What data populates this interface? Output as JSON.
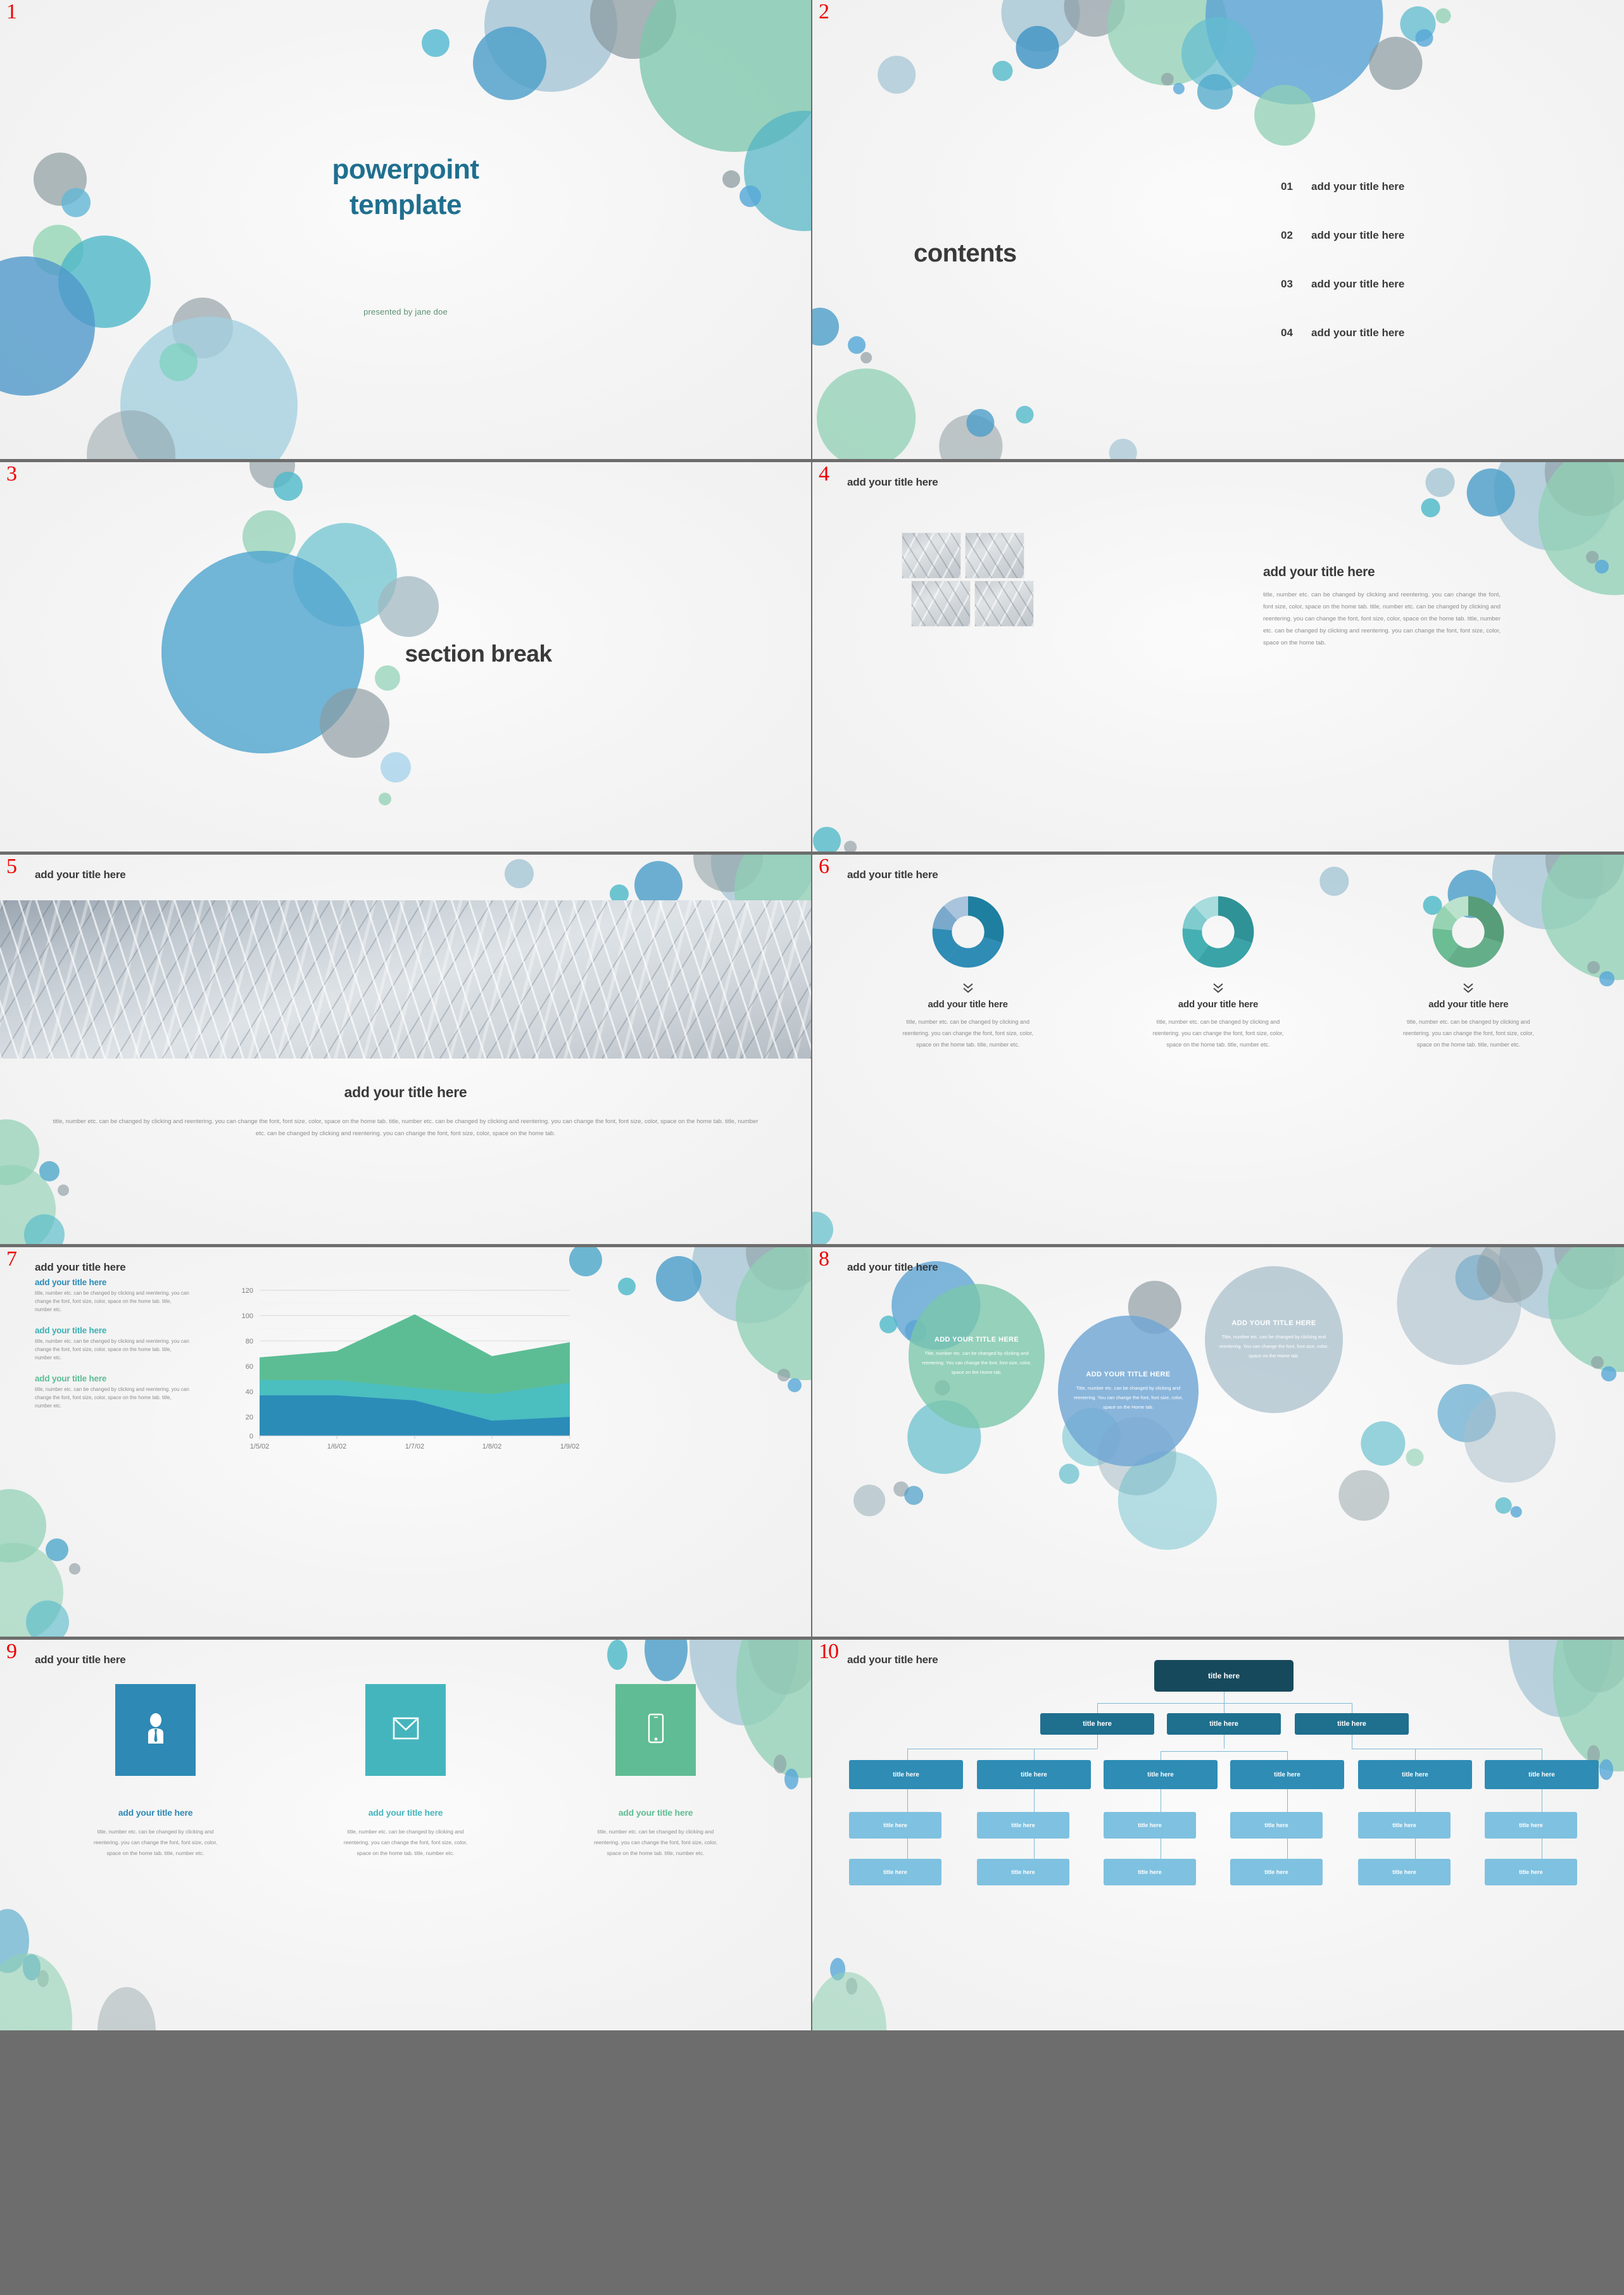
{
  "deck": {
    "slide_numbers": [
      "1",
      "2",
      "3",
      "4",
      "5",
      "6",
      "7",
      "8",
      "9",
      "10"
    ]
  },
  "slide1": {
    "title_line1": "powerpoint",
    "title_line2": "template",
    "subtitle": "presented by jane doe",
    "title_color": "#1f6f8f",
    "subtitle_color": "#5c8f73"
  },
  "slide2": {
    "heading": "contents",
    "items": [
      {
        "num": "01",
        "label": "add your title here"
      },
      {
        "num": "02",
        "label": "add your title here"
      },
      {
        "num": "03",
        "label": "add your title here"
      },
      {
        "num": "04",
        "label": "add your title here"
      }
    ]
  },
  "slide3": {
    "title": "section break"
  },
  "slide4": {
    "header": "add your title here",
    "body_title": "add your title here",
    "body_text": "title, number etc. can be changed by clicking and reentering. you can change the font, font size, color, space on the home tab. title, number etc. can be changed by clicking and reentering. you can change the font, font size, color, space on the home tab. title, number etc. can be changed by clicking and reentering. you can change the font, font size, color, space on the home tab.",
    "image_count": 4
  },
  "slide5": {
    "header": "add your title here",
    "title": "add your title here",
    "body_text": "title, number etc. can be changed by clicking and reentering. you can change the font, font size, color, space on the home tab. title, number etc. can be changed by clicking and reentering. you can change the font, font size, color, space on the home tab. title, number etc. can be changed by clicking and reentering. you can change the font, font size, color, space on the home tab."
  },
  "slide6": {
    "header": "add your title here",
    "columns": [
      {
        "title": "add your title here",
        "text": "title, number etc. can be changed by clicking and reentering. you can change the font, font size, color, space on the home tab. title, number etc."
      },
      {
        "title": "add your title here",
        "text": "title, number etc. can be changed by clicking and reentering. you can change the font, font size, color, space on the home tab. title, number etc."
      },
      {
        "title": "add your title here",
        "text": "title, number etc. can be changed by clicking and reentering. you can change the font, font size, color, space on the home tab. title, number etc."
      }
    ]
  },
  "slide7": {
    "header": "add your title here",
    "blocks": [
      {
        "title": "add your title here",
        "text": "title, number etc. can be changed by clicking and reentering. you can change the font, font size, color, space on the home tab. title, number etc.",
        "color": "#2b8cb8"
      },
      {
        "title": "add your title here",
        "text": "title, number etc. can be changed by clicking and reentering. you can change the font, font size, color, space on the home tab. title, number etc.",
        "color": "#3cb0b5"
      },
      {
        "title": "add your title here",
        "text": "title, number etc. can be changed by clicking and reentering. you can change the font, font size, color, space on the home tab. title, number etc.",
        "color": "#5cbd95"
      }
    ]
  },
  "slide8": {
    "header": "add your title here",
    "bubbles": [
      {
        "title": "ADD YOUR TITLE HERE",
        "text": "Title, number etc. can be changed by clicking and reentering. You can change the font, font size, color, space on the Home tab.",
        "color": "#7ac7ab"
      },
      {
        "title": "ADD YOUR TITLE HERE",
        "text": "Title, number etc. can be changed by clicking and reentering. You can change the font, font size, color, space on the Home tab.",
        "color": "#70a6d4"
      },
      {
        "title": "ADD YOUR TITLE HERE",
        "text": "Title, number etc. can be changed by clicking and reentering. You can change the font, font size, color, space on the Home tab.",
        "color": "#a8becb"
      }
    ]
  },
  "slide9": {
    "header": "add your title here",
    "columns": [
      {
        "icon": "person-icon",
        "color": "#2e89b5",
        "title": "add your title here",
        "text": "title, number etc. can be changed by clicking and reentering. you can change the font, font size, color, space on the home tab. title, number etc."
      },
      {
        "icon": "envelope-icon",
        "color": "#45b5bd",
        "title": "add your title here",
        "text": "title, number etc. can be changed by clicking and reentering. you can change the font, font size, color, space on the home tab. title, number etc."
      },
      {
        "icon": "smartphone-icon",
        "color": "#60bc94",
        "title": "add your title here",
        "text": "title, number etc. can be changed by clicking and reentering. you can change the font, font size, color, space on the home tab. title, number etc."
      }
    ]
  },
  "slide10": {
    "header": "add your title here",
    "node_label": "title here",
    "levels": [
      {
        "count": 1,
        "color": "#17495c"
      },
      {
        "count": 3,
        "color": "#1f6f8f"
      },
      {
        "count": 6,
        "color": "#2e8cb5"
      },
      {
        "count": 6,
        "color": "#7fc1e0"
      },
      {
        "count": 6,
        "color": "#7fc1e0"
      }
    ]
  },
  "chart_data": [
    {
      "id": "slide6-donut-1",
      "type": "pie",
      "title": "",
      "labels": [
        "segment 1",
        "segment 2",
        "segment 3",
        "segment 4"
      ],
      "values": [
        46,
        28,
        12,
        14
      ],
      "colors": [
        "#1f7fa0",
        "#2e8cb5",
        "#7aa9cb",
        "#a9c4dc"
      ],
      "donut": true,
      "legend": "none"
    },
    {
      "id": "slide6-donut-2",
      "type": "pie",
      "title": "",
      "labels": [
        "segment 1",
        "segment 2",
        "segment 3",
        "segment 4"
      ],
      "values": [
        46,
        28,
        12,
        14
      ],
      "colors": [
        "#2f9296",
        "#45b0b3",
        "#7fcbcd",
        "#a8dcdd"
      ],
      "donut": true,
      "legend": "none"
    },
    {
      "id": "slide6-donut-3",
      "type": "pie",
      "title": "",
      "labels": [
        "segment 1",
        "segment 2",
        "segment 3",
        "segment 4"
      ],
      "values": [
        46,
        28,
        12,
        14
      ],
      "colors": [
        "#589d79",
        "#6bbd94",
        "#96d3b2",
        "#bae2cc"
      ],
      "donut": true,
      "legend": "none"
    },
    {
      "id": "slide7-area",
      "type": "area",
      "title": "",
      "stacked": true,
      "x": [
        "1/5/02",
        "1/6/02",
        "1/7/02",
        "1/8/02",
        "1/9/02"
      ],
      "xlabel": "",
      "ylabel": "",
      "ylim": [
        0,
        120
      ],
      "yticks": [
        0,
        20,
        40,
        60,
        80,
        100,
        120
      ],
      "grid": true,
      "legend": "none",
      "series": [
        {
          "name": "series 1",
          "color": "#2b8cb8",
          "values": [
            32,
            32,
            28,
            12,
            15
          ]
        },
        {
          "name": "series 2",
          "color": "#4bbec0",
          "values": [
            12,
            12,
            10,
            21,
            27
          ]
        },
        {
          "name": "series 3",
          "color": "#5cbd95",
          "values": [
            18,
            23,
            58,
            30,
            42
          ]
        }
      ]
    }
  ]
}
